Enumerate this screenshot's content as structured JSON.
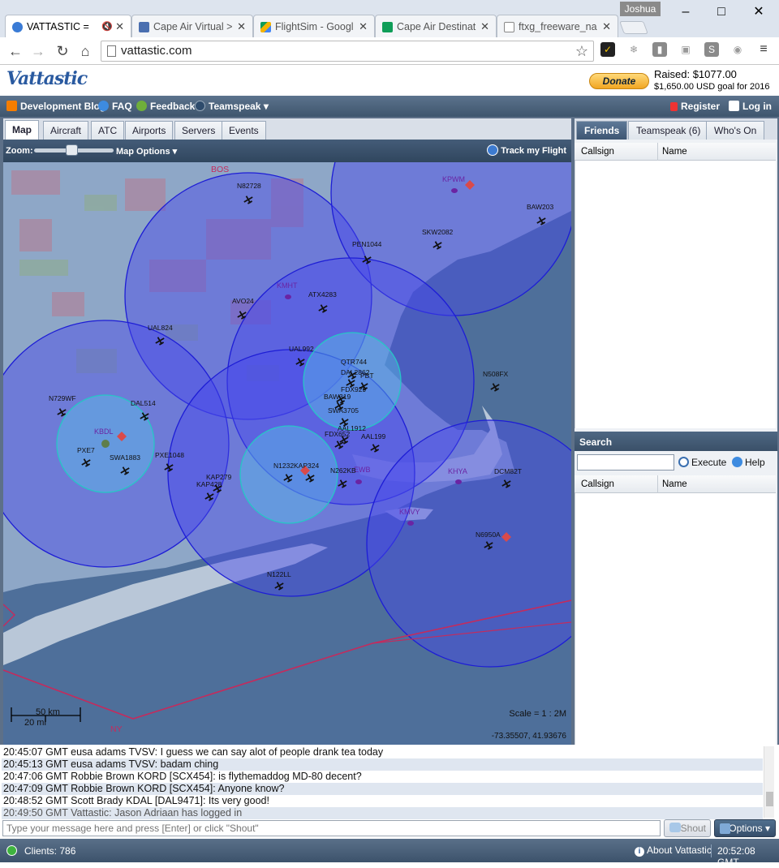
{
  "browser": {
    "user": "Joshua",
    "tabs": [
      {
        "title": "VATTASTIC = ",
        "active": true,
        "icon_color": "#3a7bd5"
      },
      {
        "title": "Cape Air Virtual >",
        "active": false,
        "icon_color": "#4a6fb0"
      },
      {
        "title": "FlightSim - Googl",
        "active": false,
        "icon_color": "#f4b400"
      },
      {
        "title": "Cape Air Destinat",
        "active": false,
        "icon_color": "#0f9d58"
      },
      {
        "title": "ftxg_freeware_na",
        "active": false,
        "icon_color": "#888888"
      }
    ],
    "url": "vattastic.com"
  },
  "header": {
    "logo": "Vattastic",
    "donate_label": "Donate",
    "raised": "Raised: $1077.00",
    "goal": "$1,650.00 USD goal for 2016"
  },
  "menubar": {
    "left": [
      "Development Blog",
      "FAQ",
      "Feedback",
      "Teamspeak"
    ],
    "register": "Register",
    "login": "Log in"
  },
  "left_tabs": [
    "Map",
    "Aircraft",
    "ATC",
    "Airports",
    "Servers",
    "Events"
  ],
  "map_toolbar": {
    "zoom_label": "Zoom:",
    "zoom_level": 0.47,
    "map_options": "Map Options",
    "track_flight": "Track my Flight"
  },
  "map": {
    "airports": [
      {
        "code": "BOS"
      },
      {
        "code": "KPWM"
      },
      {
        "code": "KMHT"
      },
      {
        "code": "KBDL"
      },
      {
        "code": "EWB"
      },
      {
        "code": "KHYA"
      },
      {
        "code": "KMVY"
      },
      {
        "code": "NY"
      }
    ],
    "aircraft": [
      "N82728",
      "PEN1044",
      "SKW2082",
      "BAW203",
      "KPWM",
      "AVO24",
      "ATX4283",
      "UAL824",
      "UAL992",
      "QTR744",
      "DAL2862",
      "PBT",
      "N508FX",
      "N729WF",
      "DAL514",
      "FDX929",
      "BAW319",
      "SWA3705",
      "FDX652",
      "AAL1912",
      "AAL199",
      "PXE7",
      "SWA1883",
      "PXE1048",
      "KAP279",
      "KAP428",
      "N1232",
      "KAP324",
      "N262KB",
      "DCM82T",
      "N6950A",
      "N122LL"
    ],
    "scale_km": "50 km",
    "scale_mi": "20 mi",
    "scale_ratio": "Scale = 1 : 2M",
    "coordinates": "-73.35507, 41.93676"
  },
  "right_tabs": [
    "Friends",
    "Teamspeak (6)",
    "Who's On"
  ],
  "grid": {
    "col_callsign": "Callsign",
    "col_name": "Name"
  },
  "search": {
    "title": "Search",
    "execute": "Execute",
    "help": "Help",
    "placeholder": ""
  },
  "chat": {
    "messages": [
      {
        "time": "20:45:07 GMT",
        "text": "eusa adams TVSV: I guess we can say alot of people drank tea today"
      },
      {
        "time": "20:45:13 GMT",
        "text": "eusa adams TVSV: badam ching"
      },
      {
        "time": "20:47:06 GMT",
        "text": "Robbie Brown KORD [SCX454]: is flythemaddog MD-80 decent?"
      },
      {
        "time": "20:47:09 GMT",
        "text": "Robbie Brown KORD [SCX454]: Anyone know?"
      },
      {
        "time": "20:48:52 GMT",
        "text": "Scott Brady KDAL [DAL9471]: Its very good!"
      },
      {
        "time": "20:49:50 GMT",
        "text": "Vattastic: Jason Adriaan has logged in"
      }
    ],
    "input_placeholder": "Type your message here and press [Enter] or click \"Shout\"",
    "shout": "Shout",
    "options": "Options"
  },
  "status": {
    "clients": "Clients: 786",
    "about": "About Vattastic",
    "time": "20:52:08 GMT"
  }
}
